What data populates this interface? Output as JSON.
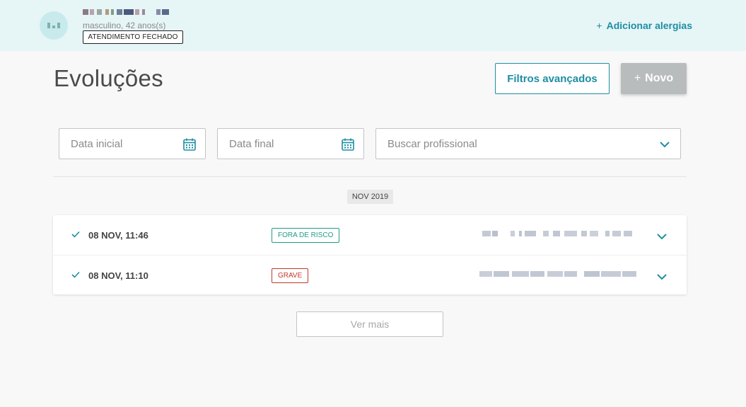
{
  "header": {
    "patient_meta": "masculino, 42 anos(s)",
    "status_badge": "ATENDIMENTO FECHADO",
    "add_allergy_label": "Adicionar alergias",
    "add_allergy_icon": "plus-icon"
  },
  "page": {
    "title": "Evoluções",
    "filters_button": "Filtros avançados",
    "new_button": "Novo",
    "new_button_icon": "plus-icon"
  },
  "filters": {
    "start_date_placeholder": "Data inicial",
    "end_date_placeholder": "Data final",
    "professional_placeholder": "Buscar profissional",
    "date_icon": "calendar-icon",
    "select_icon": "chevron-down-icon"
  },
  "timeline": {
    "month_label": "NOV 2019",
    "entries": [
      {
        "date": "08 NOV, 11:46",
        "status": "FORA DE RISCO",
        "status_color": "#1c9e8a",
        "status_icon": "check-icon"
      },
      {
        "date": "08 NOV, 11:10",
        "status": "GRAVE",
        "status_color": "#c0392b",
        "status_icon": "check-icon"
      }
    ],
    "more_button": "Ver mais"
  },
  "colors": {
    "accent": "#1e8ea3",
    "header_bg": "#e6f5f6",
    "disabled_button": "#b9bcbd"
  }
}
